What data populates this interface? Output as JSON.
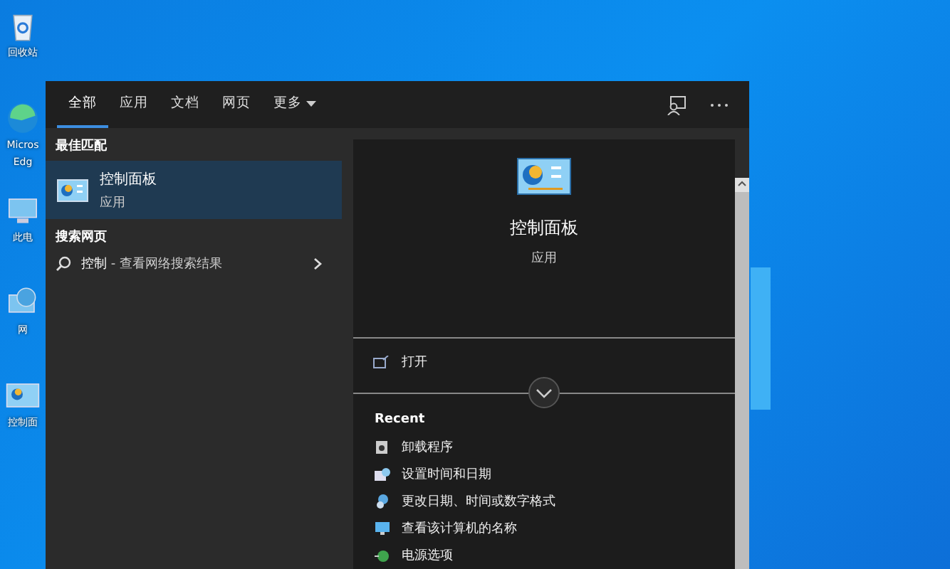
{
  "desktop_icons": [
    {
      "kind": "recycle-bin",
      "lines": [
        "回收站"
      ]
    },
    {
      "kind": "browser",
      "lines": [
        "Micros",
        "Edg"
      ]
    },
    {
      "kind": "computer",
      "lines": [
        "此电"
      ]
    },
    {
      "kind": "network",
      "lines": [
        "网"
      ]
    },
    {
      "kind": "control-panel",
      "lines": [
        "控制面"
      ]
    }
  ],
  "search": {
    "tabs": [
      {
        "label": "全部",
        "selected": true,
        "kind": "tab"
      },
      {
        "label": "应用",
        "selected": false,
        "kind": "tab"
      },
      {
        "label": "文档",
        "selected": false,
        "kind": "tab"
      },
      {
        "label": "网页",
        "selected": false,
        "kind": "tab"
      },
      {
        "label": "更多",
        "selected": false,
        "kind": "dropdown"
      }
    ],
    "best_match": {
      "heading": "最佳匹配",
      "title": "控制面板",
      "subtitle": "应用",
      "selected": true
    },
    "web": {
      "heading": "搜索网页",
      "text": "**控制** - 查看网络搜索结果"
    },
    "preview": {
      "title": "控制面板",
      "subtitle": "应用",
      "actions": [
        {
          "label": "打开"
        }
      ],
      "recent_heading": "Recent",
      "recent": [
        {
          "label": "卸载程序",
          "kind": "program"
        },
        {
          "label": "设置时间和日期",
          "kind": "clock"
        },
        {
          "label": "更改日期、时间或数字格式",
          "kind": "globe"
        },
        {
          "label": "查看该计算机的名称",
          "kind": "monitor"
        },
        {
          "label": "电源选项",
          "kind": "power"
        }
      ]
    }
  }
}
